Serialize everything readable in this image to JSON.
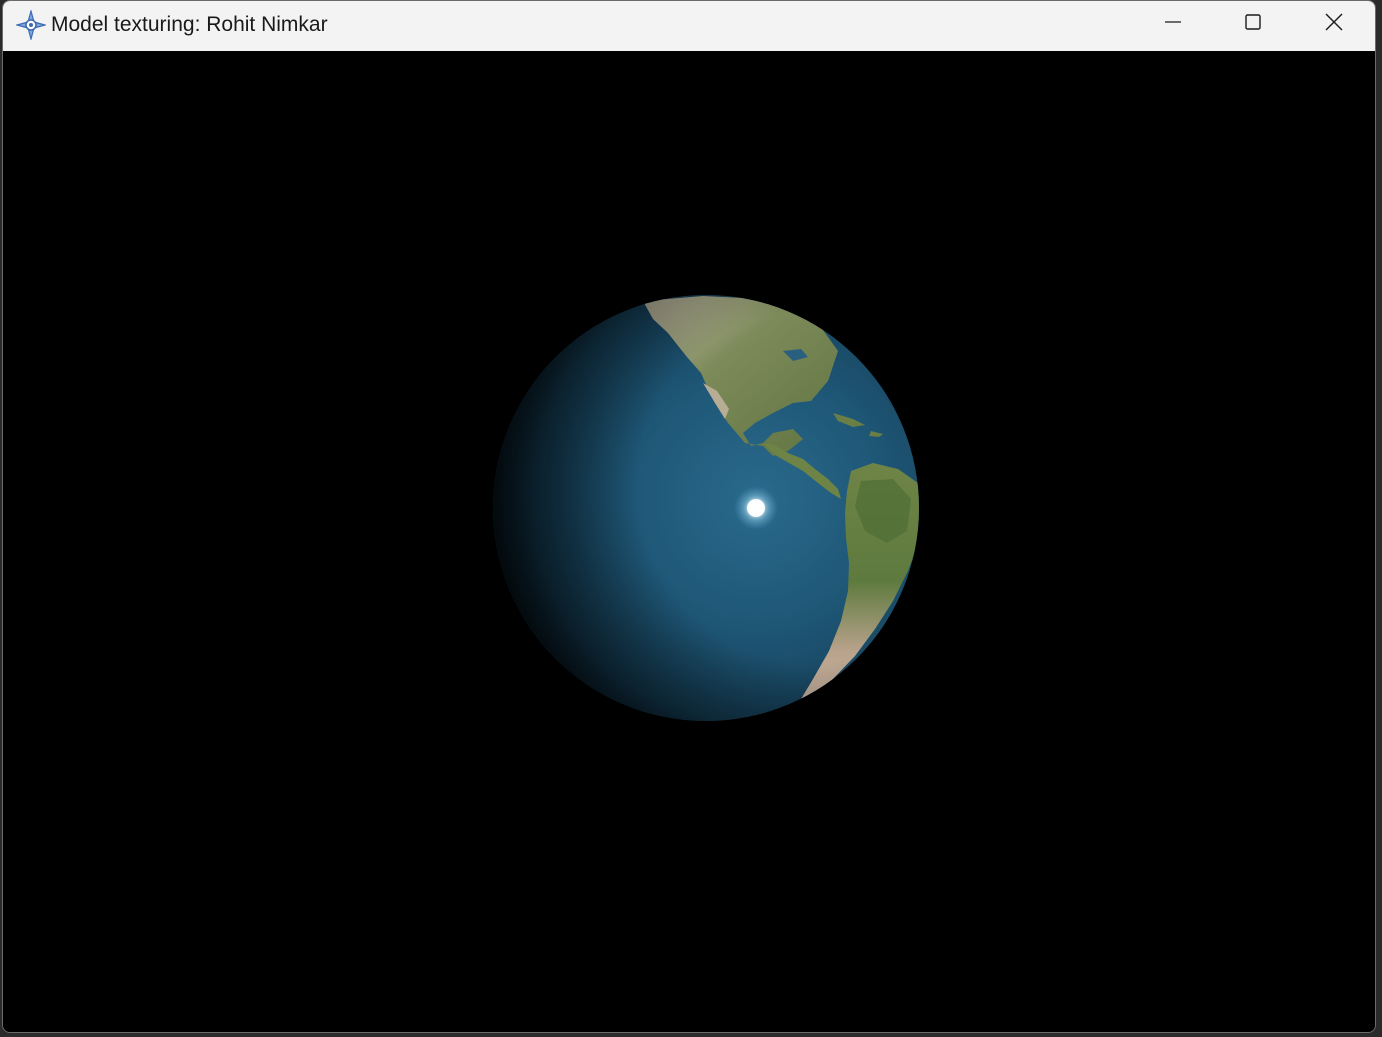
{
  "window": {
    "title": "Model texturing: Rohit Nimkar",
    "app_icon": "opengl-app-icon",
    "controls": {
      "minimize": "minimize-icon",
      "maximize": "maximize-icon",
      "close": "close-icon"
    }
  },
  "scene": {
    "background_color": "#000000",
    "object": "textured-earth-sphere",
    "ocean_color": "#1f5878",
    "specular_color": "#ffffff"
  }
}
